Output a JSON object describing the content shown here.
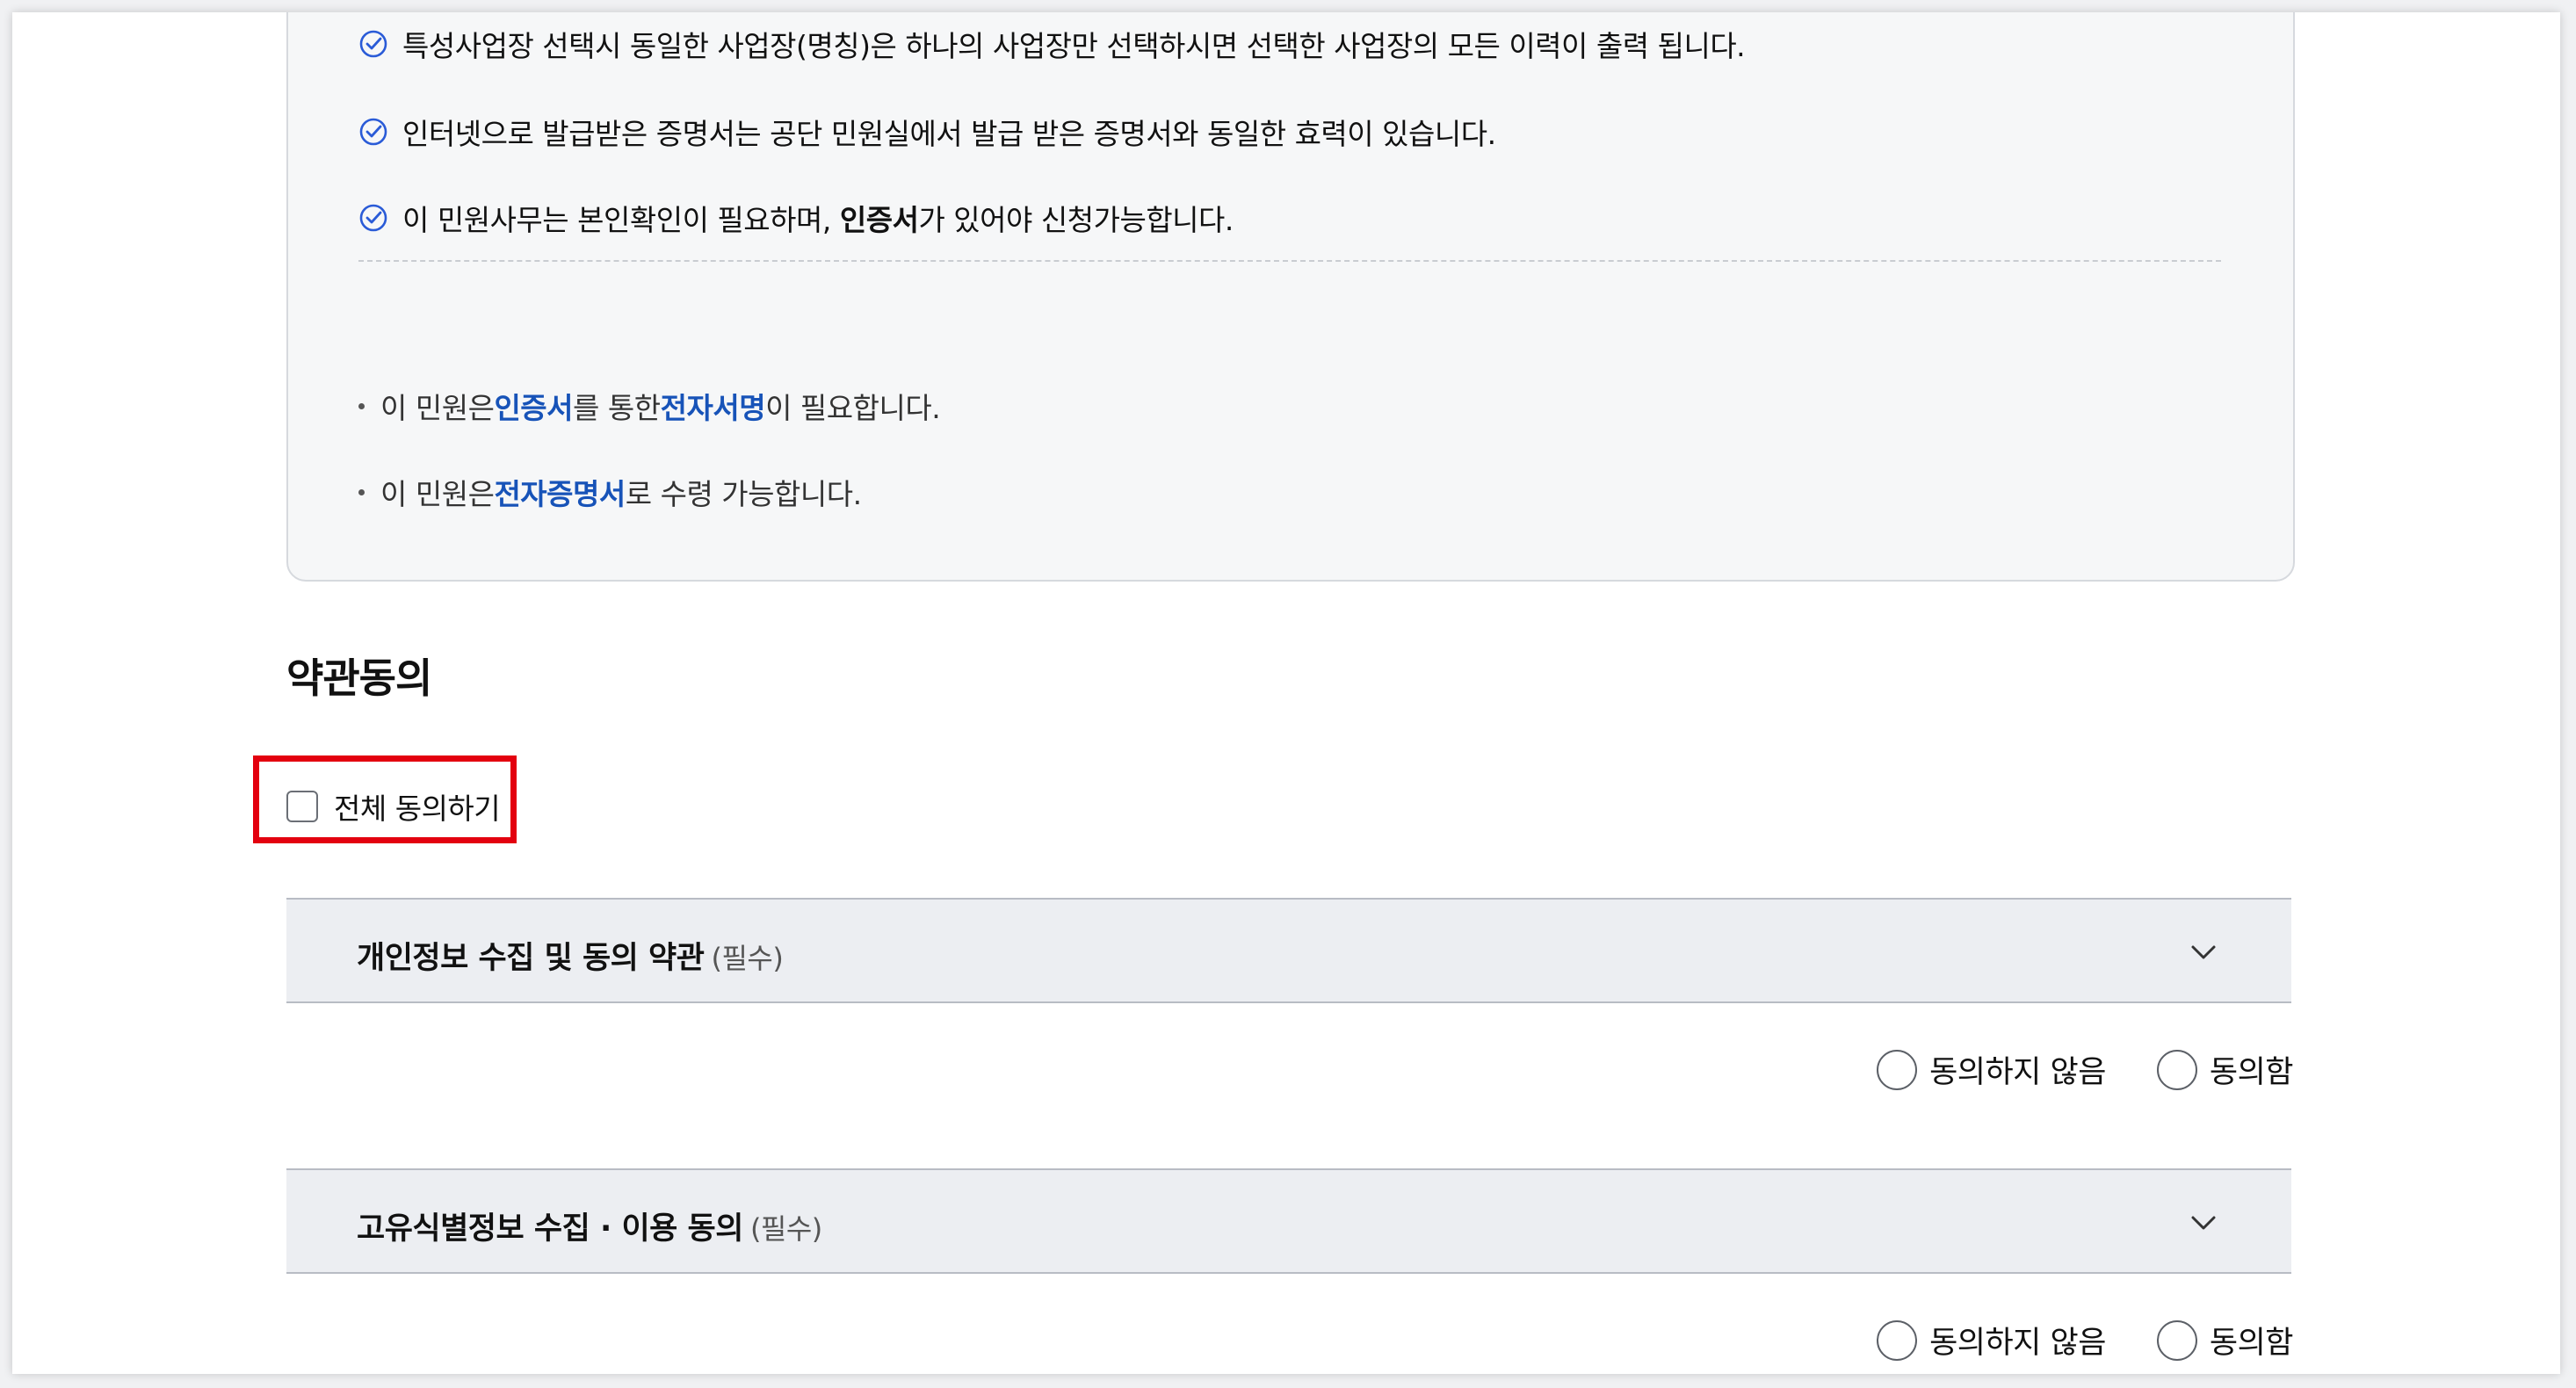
{
  "notice": {
    "checks": [
      {
        "text": "특성사업장 선택시 동일한 사업장(명칭)은 하나의 사업장만 선택하시면 선택한 사업장의 모든 이력이 출력 됩니다."
      },
      {
        "text": "인터넷으로 발급받은 증명서는 공단 민원실에서 발급 받은 증명서와 동일한 효력이 있습니다."
      },
      {
        "pre": "이 민원사무는 본인확인이 필요하며, ",
        "strong": "인증서",
        "post": "가 있어야 신청가능합니다."
      }
    ],
    "bullets": [
      {
        "p1": "이 민원은 ",
        "h1": "인증서",
        "p2": "를 통한 ",
        "h2": "전자서명",
        "p3": "이 필요합니다."
      },
      {
        "p1": "이 민원은 ",
        "h1": "전자증명서",
        "p2": "로 수령 가능합니다."
      }
    ]
  },
  "terms": {
    "title": "약관동의",
    "agree_all_label": "전체 동의하기",
    "items": [
      {
        "title": "개인정보 수집 및 동의 약관",
        "required": "(필수)",
        "disagree_label": "동의하지 않음",
        "agree_label": "동의함"
      },
      {
        "title": "고유식별정보 수집 · 이용 동의",
        "required": "(필수)",
        "disagree_label": "동의하지 않음",
        "agree_label": "동의함"
      }
    ]
  },
  "colors": {
    "highlight_blue": "#1753b8",
    "check_icon_blue": "#2a5bd7",
    "annotation_red": "#e3000f",
    "accordion_bg": "#eceef2"
  }
}
